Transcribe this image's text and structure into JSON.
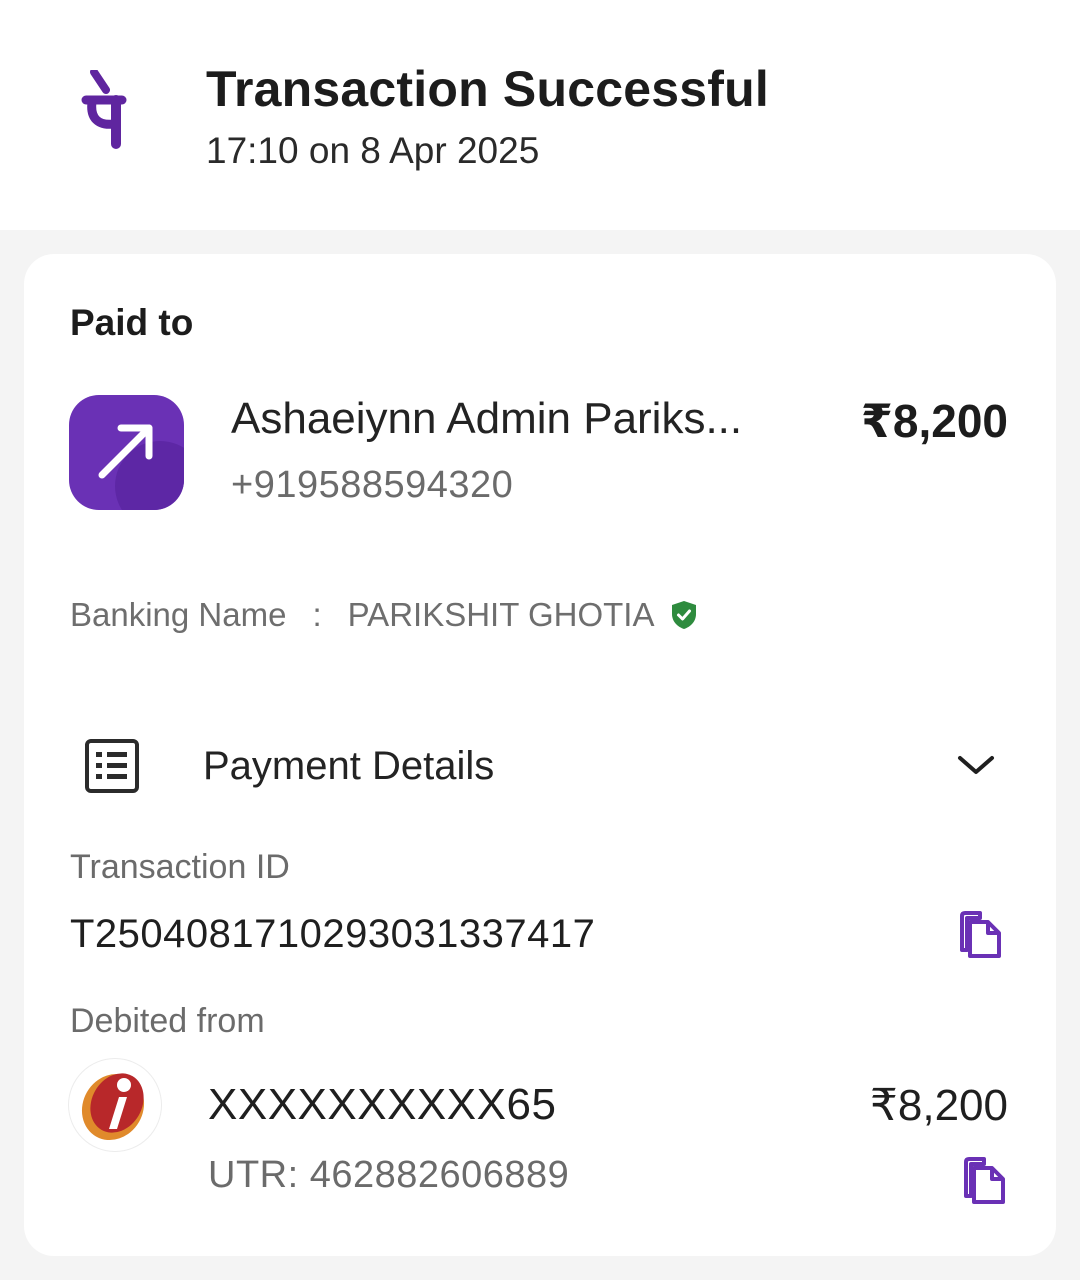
{
  "header": {
    "brand_glyph": "पे",
    "title": "Transaction Successful",
    "timestamp": "17:10 on 8 Apr 2025"
  },
  "paid_to": {
    "label": "Paid to",
    "name": "Ashaeiynn Admin Pariks...",
    "phone": "+919588594320",
    "amount": "₹8,200",
    "avatar_icon": "arrow-up-right-icon"
  },
  "banking": {
    "label": "Banking Name",
    "separator": ":",
    "value": "PARIKSHIT GHOTIA",
    "verified_icon": "shield-check-icon"
  },
  "payment_details": {
    "title": "Payment Details",
    "icon": "receipt-list-icon",
    "expand_icon": "chevron-down-icon",
    "transaction_id_label": "Transaction ID",
    "transaction_id": "T2504081710293031337417",
    "debited_from_label": "Debited from",
    "account_number": "XXXXXXXXXX65",
    "utr": "UTR: 462882606889",
    "debit_amount": "₹8,200",
    "bank_logo": "icici-bank-logo"
  },
  "colors": {
    "brand_purple": "#5f259f",
    "accent_purple": "#6a31b5",
    "verified_green": "#2e8b3e",
    "page_background": "#f4f4f4"
  }
}
